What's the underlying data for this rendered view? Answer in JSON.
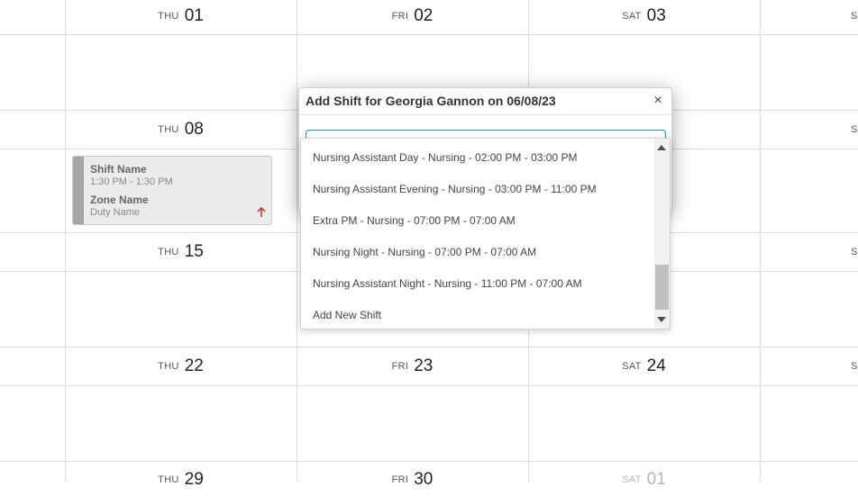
{
  "calendar": {
    "rows": [
      [
        {
          "dow": "THU",
          "num": "01"
        },
        {
          "dow": "FRI",
          "num": "02"
        },
        {
          "dow": "SAT",
          "num": "03"
        },
        {
          "dow": "S",
          "num": ""
        }
      ],
      [
        {
          "dow": "THU",
          "num": "08"
        },
        {
          "dow": "",
          "num": ""
        },
        {
          "dow": "",
          "num": ""
        },
        {
          "dow": "S",
          "num": ""
        }
      ],
      [
        {
          "dow": "THU",
          "num": "15"
        },
        {
          "dow": "",
          "num": ""
        },
        {
          "dow": "",
          "num": ""
        },
        {
          "dow": "S",
          "num": ""
        }
      ],
      [
        {
          "dow": "THU",
          "num": "22"
        },
        {
          "dow": "FRI",
          "num": "23"
        },
        {
          "dow": "SAT",
          "num": "24"
        },
        {
          "dow": "S",
          "num": ""
        }
      ],
      [
        {
          "dow": "THU",
          "num": "29"
        },
        {
          "dow": "FRI",
          "num": "30"
        },
        {
          "dow": "SAT",
          "num": "01"
        },
        {
          "dow": "",
          "num": ""
        }
      ]
    ]
  },
  "shift_card": {
    "shift_name": "Shift Name",
    "time": "1:30 PM - 1:30 PM",
    "zone_name": "Zone Name",
    "duty_name": "Duty Name",
    "icon": "arrow-up-icon",
    "arrow_color": "#c0392b"
  },
  "modal": {
    "title": "Add Shift for Georgia Gannon on 06/08/23",
    "close_label": "×",
    "accent_color": "#1e88e5"
  },
  "dropdown": {
    "options": [
      "Nursing Assistant Day - Nursing - 02:00 PM - 03:00 PM",
      "Nursing Assistant Evening - Nursing - 03:00 PM - 11:00 PM",
      "Extra PM - Nursing - 07:00 PM - 07:00 AM",
      "Nursing Night - Nursing - 07:00 PM - 07:00 AM",
      "Nursing Assistant Night - Nursing - 11:00 PM - 07:00 AM",
      "Add New Shift"
    ]
  }
}
